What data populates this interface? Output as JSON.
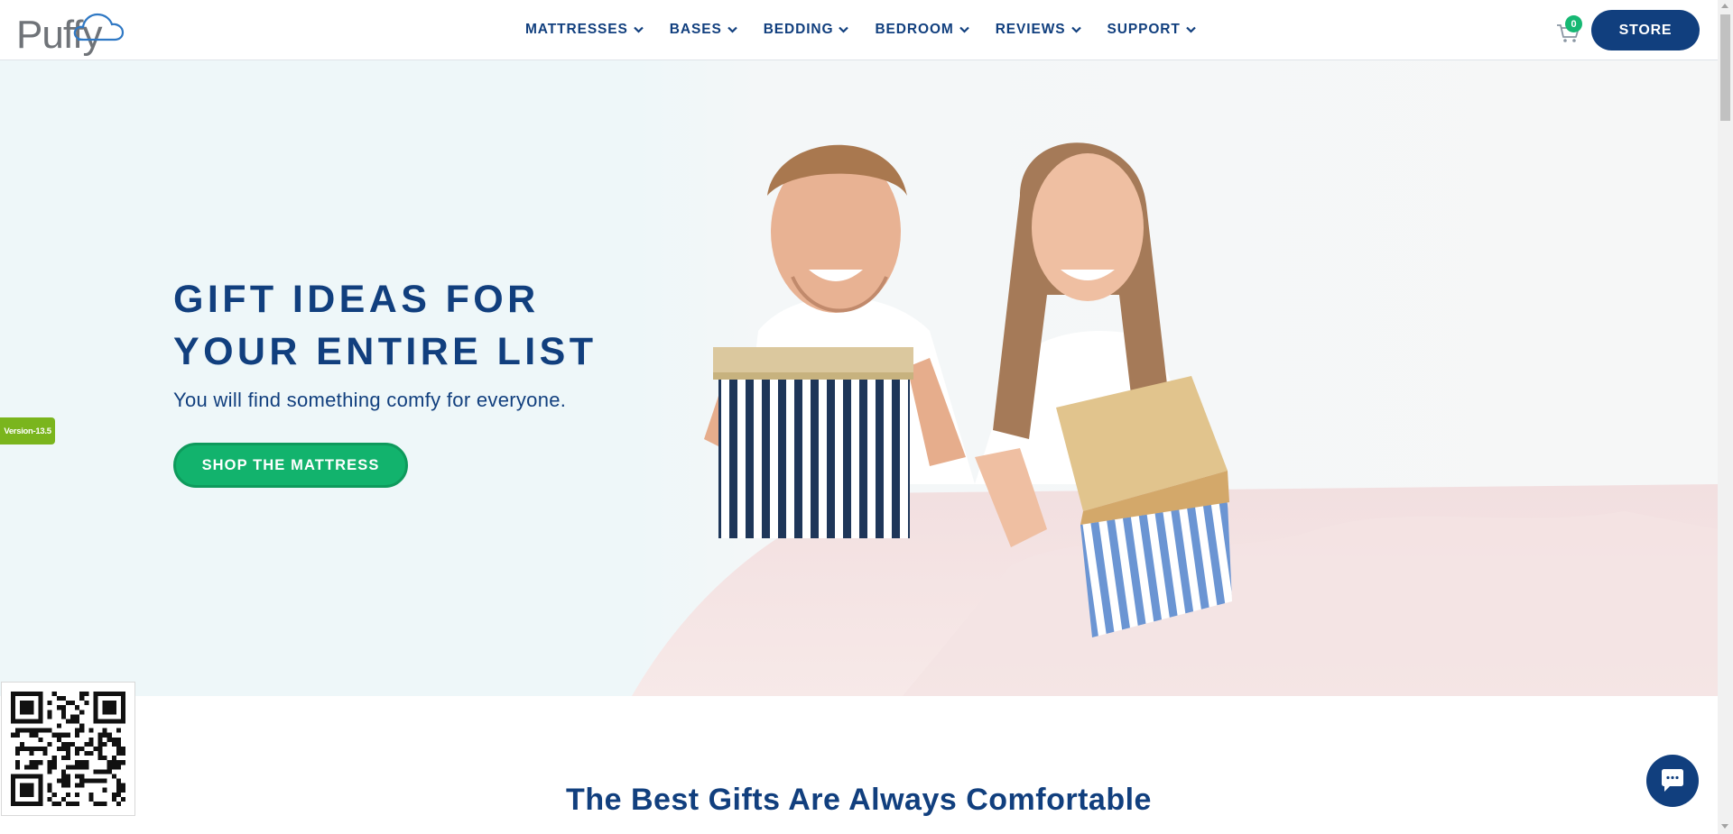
{
  "header": {
    "logo_text": "Puffy",
    "nav": [
      {
        "label": "MATTRESSES"
      },
      {
        "label": "BASES"
      },
      {
        "label": "BEDDING"
      },
      {
        "label": "BEDROOM"
      },
      {
        "label": "REVIEWS"
      },
      {
        "label": "SUPPORT"
      }
    ],
    "cart_count": "0",
    "store_label": "STORE"
  },
  "hero": {
    "title_line1": "GIFT IDEAS FOR",
    "title_line2": "YOUR ENTIRE LIST",
    "subtitle": "You will find something comfy for everyone.",
    "cta_label": "SHOP THE MATTRESS"
  },
  "version_tag": "Version-13.5",
  "section": {
    "title": "The Best Gifts Are Always Comfortable"
  },
  "colors": {
    "brand_blue": "#113f7e",
    "cta_green": "#12b36d",
    "badge_green": "#16b873",
    "version_green": "#7ab51d",
    "hero_bg": "#eef7f9"
  },
  "icons": {
    "cart": "cart-icon",
    "chevron": "chevron-down-icon",
    "chat": "chat-bubble-icon",
    "logo_cloud": "cloud-icon"
  }
}
